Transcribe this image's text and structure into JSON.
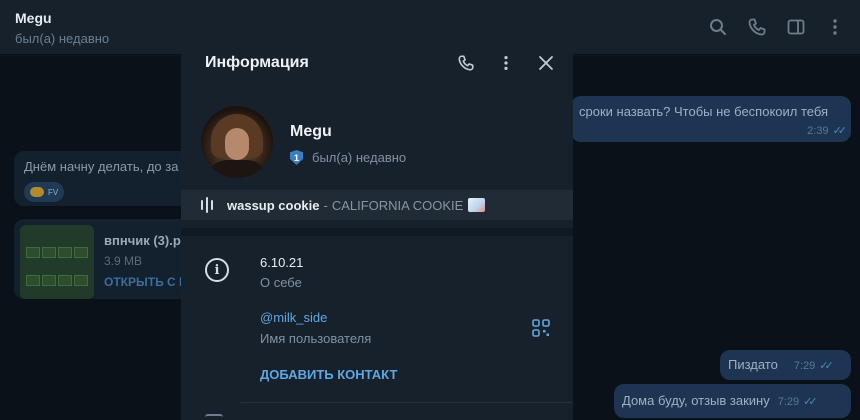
{
  "header": {
    "title": "Megu",
    "status": "был(а) недавно"
  },
  "messages": {
    "incoming_text": "Днём начну делать, до за",
    "reaction_tag": "FV",
    "file": {
      "name": "впнчик (3).p",
      "size": "3.9 MB",
      "action": "ОТКРЫТЬ С I"
    },
    "outgoing": [
      {
        "text": "сроки назвать? Чтобы не беспокоил тебя",
        "time": "2:39"
      },
      {
        "text": "Пиздато",
        "time": "7:29"
      },
      {
        "text": "Дома буду, отзыв закину",
        "time": "7:29"
      }
    ]
  },
  "modal": {
    "title": "Информация",
    "name": "Megu",
    "badge": "1",
    "status": "был(а) недавно",
    "music": {
      "title": "wassup cookie",
      "separator": "-",
      "artist": "CALIFORNIA COOKIE"
    },
    "bio_value": "6.10.21",
    "bio_label": "О себе",
    "username_value": "@milk_side",
    "username_label": "Имя пользователя",
    "add_contact": "ДОБАВИТЬ КОНТАКТ"
  },
  "icons": {
    "header": [
      "search-icon",
      "phone-icon",
      "sidebar-toggle-icon",
      "more-vertical-icon"
    ],
    "modal": [
      "phone-icon",
      "more-vertical-icon",
      "close-icon"
    ]
  },
  "colors": {
    "background": "#0e1621",
    "panel": "#17212b",
    "accent": "#5fa7e2",
    "outgoing_bubble": "#1d3552"
  }
}
